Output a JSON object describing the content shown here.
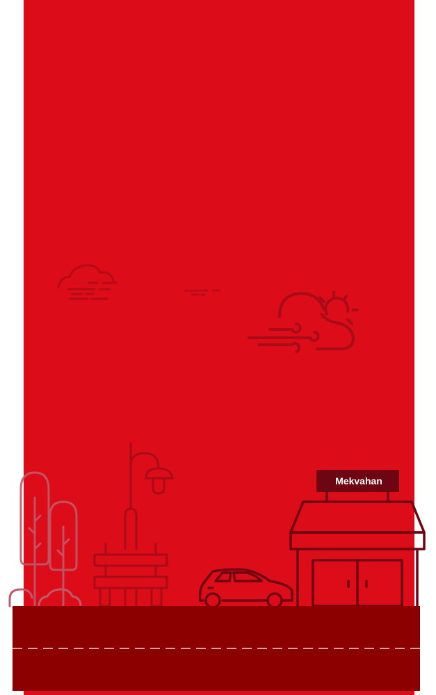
{
  "store": {
    "sign_label": "Mekvahan"
  },
  "colors": {
    "panel": "#dc0c18",
    "road": "#8c0000",
    "line_art": "#6e0512",
    "faint_art": "#b30c18",
    "road_dash": "#d9a2a2"
  },
  "icons": [
    "cloud-icon",
    "cloud-wind-sun-icon",
    "tree-icon",
    "street-lamp-icon",
    "bench-icon",
    "car-icon",
    "store-icon"
  ]
}
